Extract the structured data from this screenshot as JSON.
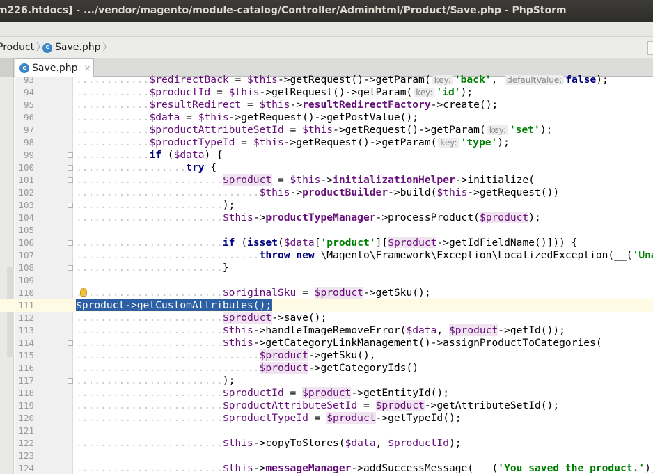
{
  "window": {
    "title": "m226.htdocs] - .../vendor/magento/module-catalog/Controller/Adminhtml/Product/Save.php - PhpStorm"
  },
  "navbar": {
    "crumbs": [
      "Product",
      "Save.php"
    ]
  },
  "tabs": [
    {
      "label": "Save.php",
      "close": "×"
    }
  ],
  "code_lines": [
    {
      "num": "93",
      "indent": 6,
      "tokens": [
        [
          "var",
          "$redirectBack"
        ],
        [
          "p",
          " = "
        ],
        [
          "var",
          "$this"
        ],
        [
          "p",
          "->getRequest()->getParam("
        ],
        [
          "hint",
          "key:"
        ],
        [
          "str",
          "'back'"
        ],
        [
          "p",
          ", "
        ],
        [
          "hint",
          "defaultValue:"
        ],
        [
          "kw",
          "false"
        ],
        [
          "p",
          ");"
        ]
      ]
    },
    {
      "num": "94",
      "indent": 6,
      "tokens": [
        [
          "var",
          "$productId"
        ],
        [
          "p",
          " = "
        ],
        [
          "var",
          "$this"
        ],
        [
          "p",
          "->getRequest()->getParam("
        ],
        [
          "hint",
          "key:"
        ],
        [
          "str",
          "'id'"
        ],
        [
          "p",
          ");"
        ]
      ]
    },
    {
      "num": "95",
      "indent": 6,
      "tokens": [
        [
          "var",
          "$resultRedirect"
        ],
        [
          "p",
          " = "
        ],
        [
          "var",
          "$this"
        ],
        [
          "p",
          "->"
        ],
        [
          "fld",
          "resultRedirectFactory"
        ],
        [
          "p",
          "->create();"
        ]
      ]
    },
    {
      "num": "96",
      "indent": 6,
      "tokens": [
        [
          "var",
          "$data"
        ],
        [
          "p",
          " = "
        ],
        [
          "var",
          "$this"
        ],
        [
          "p",
          "->getRequest()->getPostValue();"
        ]
      ]
    },
    {
      "num": "97",
      "indent": 6,
      "tokens": [
        [
          "var",
          "$productAttributeSetId"
        ],
        [
          "p",
          " = "
        ],
        [
          "var",
          "$this"
        ],
        [
          "p",
          "->getRequest()->getParam("
        ],
        [
          "hint",
          "key:"
        ],
        [
          "str",
          "'set'"
        ],
        [
          "p",
          ");"
        ]
      ]
    },
    {
      "num": "98",
      "indent": 6,
      "tokens": [
        [
          "var",
          "$productTypeId"
        ],
        [
          "p",
          " = "
        ],
        [
          "var",
          "$this"
        ],
        [
          "p",
          "->getRequest()->getParam("
        ],
        [
          "hint",
          "key:"
        ],
        [
          "str",
          "'type'"
        ],
        [
          "p",
          ");"
        ]
      ]
    },
    {
      "num": "99",
      "indent": 6,
      "fold": true,
      "tokens": [
        [
          "kw",
          "if"
        ],
        [
          "p",
          " ("
        ],
        [
          "var",
          "$data"
        ],
        [
          "p",
          ") {"
        ]
      ]
    },
    {
      "num": "100",
      "indent": 9,
      "fold": true,
      "tokens": [
        [
          "kw",
          "try"
        ],
        [
          "p",
          " {"
        ]
      ]
    },
    {
      "num": "101",
      "indent": 12,
      "fold": true,
      "tokens": [
        [
          "loc",
          "$product"
        ],
        [
          "p",
          " = "
        ],
        [
          "var",
          "$this"
        ],
        [
          "p",
          "->"
        ],
        [
          "fld",
          "initializationHelper"
        ],
        [
          "p",
          "->initialize("
        ]
      ]
    },
    {
      "num": "102",
      "indent": 15,
      "tokens": [
        [
          "var",
          "$this"
        ],
        [
          "p",
          "->"
        ],
        [
          "fld",
          "productBuilder"
        ],
        [
          "p",
          "->build("
        ],
        [
          "var",
          "$this"
        ],
        [
          "p",
          "->getRequest())"
        ]
      ]
    },
    {
      "num": "103",
      "indent": 12,
      "fold": true,
      "tokens": [
        [
          "p",
          ");"
        ]
      ]
    },
    {
      "num": "104",
      "indent": 12,
      "tokens": [
        [
          "var",
          "$this"
        ],
        [
          "p",
          "->"
        ],
        [
          "fld",
          "productTypeManager"
        ],
        [
          "p",
          "->processProduct("
        ],
        [
          "loc",
          "$product"
        ],
        [
          "p",
          ");"
        ]
      ]
    },
    {
      "num": "105",
      "indent": 0,
      "tokens": []
    },
    {
      "num": "106",
      "indent": 12,
      "fold": true,
      "tokens": [
        [
          "kw",
          "if"
        ],
        [
          "p",
          " ("
        ],
        [
          "kw",
          "isset"
        ],
        [
          "p",
          "("
        ],
        [
          "var",
          "$data"
        ],
        [
          "p",
          "["
        ],
        [
          "str",
          "'product'"
        ],
        [
          "p",
          "]["
        ],
        [
          "loc",
          "$product"
        ],
        [
          "p",
          "->getIdFieldName()])) {"
        ]
      ]
    },
    {
      "num": "107",
      "indent": 15,
      "tokens": [
        [
          "kw",
          "throw new"
        ],
        [
          "p",
          " \\Magento\\Framework\\Exception\\LocalizedException(__("
        ],
        [
          "str",
          "'Unable to sa"
        ]
      ]
    },
    {
      "num": "108",
      "indent": 12,
      "fold": true,
      "tokens": [
        [
          "p",
          "}"
        ]
      ]
    },
    {
      "num": "109",
      "indent": 0,
      "tokens": []
    },
    {
      "num": "110",
      "indent": 12,
      "bulb": true,
      "tokens": [
        [
          "var",
          "$originalSku"
        ],
        [
          "p",
          " = "
        ],
        [
          "loc",
          "$product"
        ],
        [
          "p",
          "->getSku();"
        ]
      ]
    },
    {
      "num": "111",
      "indent": 0,
      "current": true,
      "tokens": [
        [
          "sel",
          "$product->getCustomAttributes();"
        ]
      ]
    },
    {
      "num": "112",
      "indent": 12,
      "tokens": [
        [
          "loc",
          "$product"
        ],
        [
          "p",
          "->save();"
        ]
      ]
    },
    {
      "num": "113",
      "indent": 12,
      "tokens": [
        [
          "var",
          "$this"
        ],
        [
          "p",
          "->handleImageRemoveError("
        ],
        [
          "var",
          "$data"
        ],
        [
          "p",
          ", "
        ],
        [
          "loc",
          "$product"
        ],
        [
          "p",
          "->getId());"
        ]
      ]
    },
    {
      "num": "114",
      "indent": 12,
      "fold": true,
      "tokens": [
        [
          "var",
          "$this"
        ],
        [
          "p",
          "->getCategoryLinkManagement()->assignProductToCategories("
        ]
      ]
    },
    {
      "num": "115",
      "indent": 15,
      "tokens": [
        [
          "loc",
          "$product"
        ],
        [
          "p",
          "->getSku(),"
        ]
      ]
    },
    {
      "num": "116",
      "indent": 15,
      "tokens": [
        [
          "loc",
          "$product"
        ],
        [
          "p",
          "->getCategoryIds()"
        ]
      ]
    },
    {
      "num": "117",
      "indent": 12,
      "fold": true,
      "tokens": [
        [
          "p",
          ");"
        ]
      ]
    },
    {
      "num": "118",
      "indent": 12,
      "tokens": [
        [
          "var",
          "$productId"
        ],
        [
          "p",
          " = "
        ],
        [
          "loc",
          "$product"
        ],
        [
          "p",
          "->getEntityId();"
        ]
      ]
    },
    {
      "num": "119",
      "indent": 12,
      "tokens": [
        [
          "var",
          "$productAttributeSetId"
        ],
        [
          "p",
          " = "
        ],
        [
          "loc",
          "$product"
        ],
        [
          "p",
          "->getAttributeSetId();"
        ]
      ]
    },
    {
      "num": "120",
      "indent": 12,
      "tokens": [
        [
          "var",
          "$productTypeId"
        ],
        [
          "p",
          " = "
        ],
        [
          "loc",
          "$product"
        ],
        [
          "p",
          "->getTypeId();"
        ]
      ]
    },
    {
      "num": "121",
      "indent": 0,
      "tokens": []
    },
    {
      "num": "122",
      "indent": 12,
      "tokens": [
        [
          "var",
          "$this"
        ],
        [
          "p",
          "->copyToStores("
        ],
        [
          "var",
          "$data"
        ],
        [
          "p",
          ", "
        ],
        [
          "var",
          "$productId"
        ],
        [
          "p",
          ");"
        ]
      ]
    },
    {
      "num": "123",
      "indent": 0,
      "tokens": []
    },
    {
      "num": "124",
      "indent": 12,
      "tokens": [
        [
          "var",
          "$this"
        ],
        [
          "p",
          "->"
        ],
        [
          "fld",
          "messageManager"
        ],
        [
          "p",
          "->addSuccessMessage(   ("
        ],
        [
          "str",
          "'You saved the product.'"
        ],
        [
          "p",
          "));"
        ]
      ]
    }
  ]
}
